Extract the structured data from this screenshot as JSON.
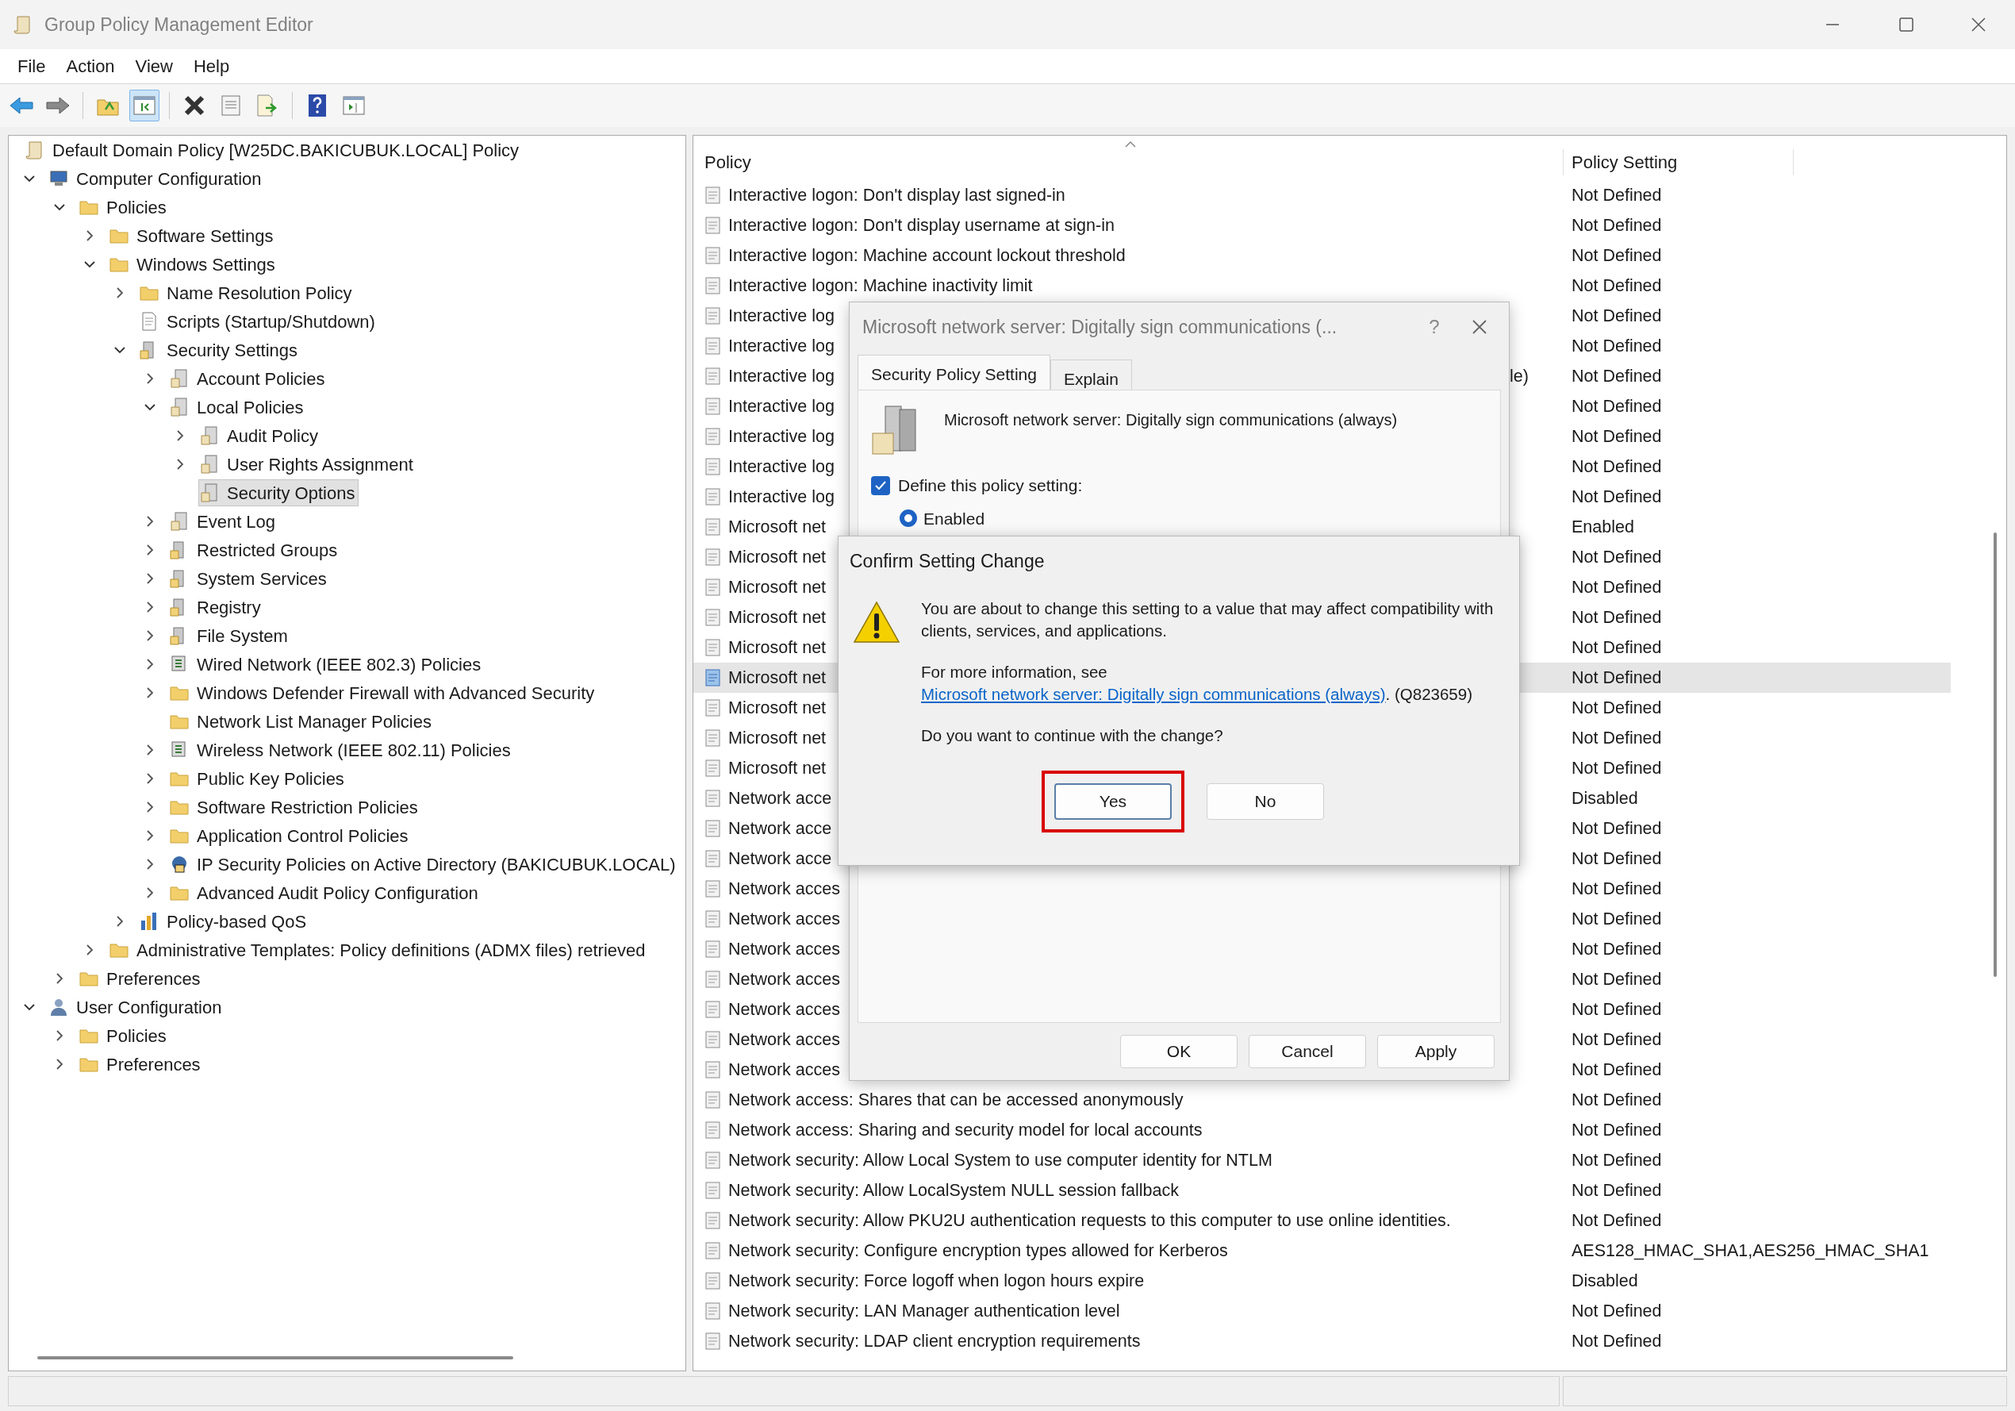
{
  "window": {
    "title": "Group Policy Management Editor"
  },
  "menu": [
    "File",
    "Action",
    "View",
    "Help"
  ],
  "toolbar": [
    {
      "kind": "back",
      "pressed": false
    },
    {
      "kind": "forward",
      "pressed": false
    },
    {
      "kind": "up",
      "pressed": false
    },
    {
      "kind": "console",
      "pressed": true
    },
    {
      "kind": "delete",
      "pressed": false
    },
    {
      "kind": "properties",
      "pressed": false
    },
    {
      "kind": "export",
      "pressed": false
    },
    {
      "kind": "help",
      "pressed": false
    },
    {
      "kind": "pane",
      "pressed": false
    }
  ],
  "tree": {
    "label": "Default Domain Policy [W25DC.BAKICUBUK.LOCAL] Policy",
    "kind": "scroll",
    "selected": false,
    "children": [
      {
        "label": "Computer Configuration",
        "kind": "computer",
        "expanded": true,
        "selected": false,
        "children": [
          {
            "label": "Policies",
            "kind": "folder",
            "expanded": true,
            "selected": false,
            "children": [
              {
                "label": "Software Settings",
                "kind": "folder",
                "expanded": false,
                "selected": false
              },
              {
                "label": "Windows Settings",
                "kind": "folder",
                "expanded": true,
                "selected": false,
                "children": [
                  {
                    "label": "Name Resolution Policy",
                    "kind": "folder",
                    "expanded": false,
                    "selected": false
                  },
                  {
                    "label": "Scripts (Startup/Shutdown)",
                    "kind": "script",
                    "selected": false
                  },
                  {
                    "label": "Security Settings",
                    "kind": "security",
                    "expanded": true,
                    "selected": false,
                    "children": [
                      {
                        "label": "Account Policies",
                        "kind": "policy",
                        "expanded": false,
                        "selected": false
                      },
                      {
                        "label": "Local Policies",
                        "kind": "policy",
                        "expanded": true,
                        "selected": false,
                        "children": [
                          {
                            "label": "Audit Policy",
                            "kind": "policy",
                            "expanded": false,
                            "selected": false
                          },
                          {
                            "label": "User Rights Assignment",
                            "kind": "policy",
                            "expanded": false,
                            "selected": false
                          },
                          {
                            "label": "Security Options",
                            "kind": "policy",
                            "selected": true
                          }
                        ]
                      },
                      {
                        "label": "Event Log",
                        "kind": "policy",
                        "expanded": false,
                        "selected": false
                      },
                      {
                        "label": "Restricted Groups",
                        "kind": "security",
                        "expanded": false,
                        "selected": false
                      },
                      {
                        "label": "System Services",
                        "kind": "security",
                        "expanded": false,
                        "selected": false
                      },
                      {
                        "label": "Registry",
                        "kind": "security",
                        "expanded": false,
                        "selected": false
                      },
                      {
                        "label": "File System",
                        "kind": "security",
                        "expanded": false,
                        "selected": false
                      },
                      {
                        "label": "Wired Network (IEEE 802.3) Policies",
                        "kind": "network",
                        "expanded": false,
                        "selected": false
                      },
                      {
                        "label": "Windows Defender Firewall with Advanced Security",
                        "kind": "folder",
                        "expanded": false,
                        "selected": false
                      },
                      {
                        "label": "Network List Manager Policies",
                        "kind": "folder",
                        "selected": false
                      },
                      {
                        "label": "Wireless Network (IEEE 802.11) Policies",
                        "kind": "network",
                        "expanded": false,
                        "selected": false
                      },
                      {
                        "label": "Public Key Policies",
                        "kind": "folder",
                        "expanded": false,
                        "selected": false
                      },
                      {
                        "label": "Software Restriction Policies",
                        "kind": "folder",
                        "expanded": false,
                        "selected": false
                      },
                      {
                        "label": "Application Control Policies",
                        "kind": "folder",
                        "expanded": false,
                        "selected": false
                      },
                      {
                        "label": "IP Security Policies on Active Directory (BAKICUBUK.LOCAL)",
                        "kind": "ipsec",
                        "expanded": false,
                        "selected": false
                      },
                      {
                        "label": "Advanced Audit Policy Configuration",
                        "kind": "folder",
                        "expanded": false,
                        "selected": false
                      }
                    ]
                  },
                  {
                    "label": "Policy-based QoS",
                    "kind": "chart",
                    "expanded": false,
                    "selected": false
                  }
                ]
              },
              {
                "label": "Administrative Templates: Policy definitions (ADMX files) retrieved",
                "kind": "folder",
                "expanded": false,
                "selected": false
              }
            ]
          },
          {
            "label": "Preferences",
            "kind": "folder",
            "expanded": false,
            "selected": false
          }
        ]
      },
      {
        "label": "User Configuration",
        "kind": "user",
        "expanded": true,
        "selected": false,
        "children": [
          {
            "label": "Policies",
            "kind": "folder",
            "expanded": false,
            "selected": false
          },
          {
            "label": "Preferences",
            "kind": "folder",
            "expanded": false,
            "selected": false
          }
        ]
      }
    ]
  },
  "list": {
    "columns": [
      "Policy",
      "Policy Setting"
    ],
    "rows": [
      {
        "policy": "Interactive logon: Don't display last signed-in",
        "setting": "Not Defined",
        "selected": false
      },
      {
        "policy": "Interactive logon: Don't display username at sign-in",
        "setting": "Not Defined",
        "selected": false
      },
      {
        "policy": "Interactive logon: Machine account lockout threshold",
        "setting": "Not Defined",
        "selected": false
      },
      {
        "policy": "Interactive logon: Machine inactivity limit",
        "setting": "Not Defined",
        "selected": false
      },
      {
        "policy": "Interactive log",
        "setting": "Not Defined",
        "selected": false
      },
      {
        "policy": "Interactive log",
        "setting": "Not Defined",
        "selected": false
      },
      {
        "policy": "Interactive log",
        "tail": "le)",
        "setting": "Not Defined",
        "selected": false
      },
      {
        "policy": "Interactive log",
        "setting": "Not Defined",
        "selected": false
      },
      {
        "policy": "Interactive log",
        "setting": "Not Defined",
        "selected": false
      },
      {
        "policy": "Interactive log",
        "setting": "Not Defined",
        "selected": false
      },
      {
        "policy": "Interactive log",
        "setting": "Not Defined",
        "selected": false
      },
      {
        "policy": "Microsoft net",
        "setting": "Enabled",
        "selected": false
      },
      {
        "policy": "Microsoft net",
        "setting": "Not Defined",
        "selected": false
      },
      {
        "policy": "Microsoft net",
        "setting": "Not Defined",
        "selected": false
      },
      {
        "policy": "Microsoft net",
        "setting": "Not Defined",
        "selected": false
      },
      {
        "policy": "Microsoft net",
        "setting": "Not Defined",
        "selected": false
      },
      {
        "policy": "Microsoft net",
        "setting": "Not Defined",
        "selected": true
      },
      {
        "policy": "Microsoft net",
        "setting": "Not Defined",
        "selected": false
      },
      {
        "policy": "Microsoft net",
        "setting": "Not Defined",
        "selected": false
      },
      {
        "policy": "Microsoft net",
        "setting": "Not Defined",
        "selected": false
      },
      {
        "policy": "Network acce",
        "setting": "Disabled",
        "selected": false
      },
      {
        "policy": "Network acce",
        "setting": "Not Defined",
        "selected": false
      },
      {
        "policy": "Network acce",
        "setting": "Not Defined",
        "selected": false
      },
      {
        "policy": "Network acces",
        "setting": "Not Defined",
        "selected": false
      },
      {
        "policy": "Network acces",
        "setting": "Not Defined",
        "selected": false
      },
      {
        "policy": "Network acces",
        "setting": "Not Defined",
        "selected": false
      },
      {
        "policy": "Network acces",
        "setting": "Not Defined",
        "selected": false
      },
      {
        "policy": "Network acces",
        "setting": "Not Defined",
        "selected": false
      },
      {
        "policy": "Network acces",
        "setting": "Not Defined",
        "selected": false
      },
      {
        "policy": "Network acces",
        "setting": "Not Defined",
        "selected": false
      },
      {
        "policy": "Network access: Shares that can be accessed anonymously",
        "setting": "Not Defined",
        "selected": false
      },
      {
        "policy": "Network access: Sharing and security model for local accounts",
        "setting": "Not Defined",
        "selected": false
      },
      {
        "policy": "Network security: Allow Local System to use computer identity for NTLM",
        "setting": "Not Defined",
        "selected": false
      },
      {
        "policy": "Network security: Allow LocalSystem NULL session fallback",
        "setting": "Not Defined",
        "selected": false
      },
      {
        "policy": "Network security: Allow PKU2U authentication requests to this computer to use online identities.",
        "setting": "Not Defined",
        "selected": false
      },
      {
        "policy": "Network security: Configure encryption types allowed for Kerberos",
        "setting": "AES128_HMAC_SHA1,AES256_HMAC_SHA1",
        "selected": false
      },
      {
        "policy": "Network security: Force logoff when logon hours expire",
        "setting": "Disabled",
        "selected": false
      },
      {
        "policy": "Network security: LAN Manager authentication level",
        "setting": "Not Defined",
        "selected": false
      },
      {
        "policy": "Network security: LDAP client encryption requirements",
        "setting": "Not Defined",
        "selected": false
      }
    ]
  },
  "properties_dialog": {
    "title": "Microsoft network server: Digitally sign communications (...",
    "help": "?",
    "tabs": [
      {
        "label": "Security Policy Setting",
        "selected": true
      },
      {
        "label": "Explain",
        "selected": false
      }
    ],
    "policy_name": "Microsoft network server: Digitally sign communications (always)",
    "define": {
      "label": "Define this policy setting:",
      "checked": true
    },
    "option": {
      "label": "Enabled",
      "selected": true
    },
    "buttons": [
      "OK",
      "Cancel",
      "Apply"
    ]
  },
  "confirm_dialog": {
    "title": "Confirm Setting Change",
    "message": "You are about to change this setting to a value that may affect compatibility with clients, services, and applications.",
    "info": {
      "before": "For more information, see ",
      "link": "Microsoft network server: Digitally sign communications (always)",
      "after": ". (Q823659)"
    },
    "question": "Do you want to continue with the change?",
    "buttons": [
      {
        "label": "Yes",
        "default": true,
        "highlighted": true
      },
      {
        "label": "No",
        "default": false,
        "highlighted": false
      }
    ]
  }
}
